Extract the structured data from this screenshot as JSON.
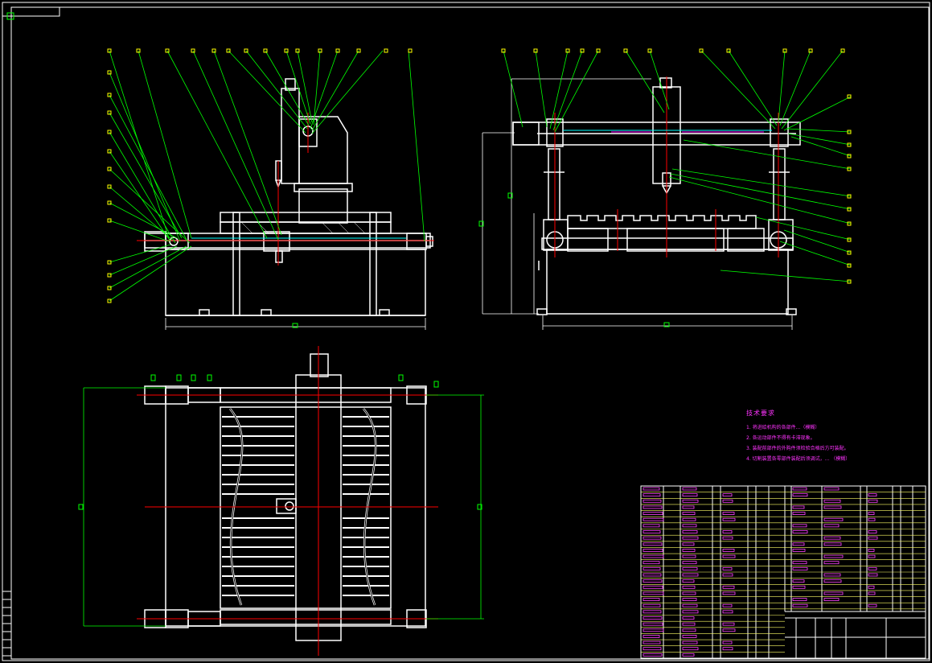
{
  "document": {
    "kind": "mechanical assembly drawing",
    "background": "#000000",
    "colors": {
      "outline": "#ffffff",
      "leader": "#00ff00",
      "centerline": "#ff0000",
      "hidden": "#ff00ff",
      "border": "#ffffff",
      "table_line": "#ffffff",
      "label_marker": "#ffff00"
    }
  },
  "technical_notes": {
    "title": "技术要求",
    "items": [
      "1. 将进给机构的各部件...（模糊）",
      "2. 各运动部件不得有卡滞现象。",
      "3. 装配前部件的外购件须检验合格后方可装配。",
      "4. 切割装置各零部件装配后须调试，... （模糊）"
    ]
  },
  "views": [
    {
      "name": "front-view"
    },
    {
      "name": "side-view"
    },
    {
      "name": "top-view"
    }
  ],
  "title_block": {
    "parts_list_rows": 28,
    "columns": 9
  }
}
